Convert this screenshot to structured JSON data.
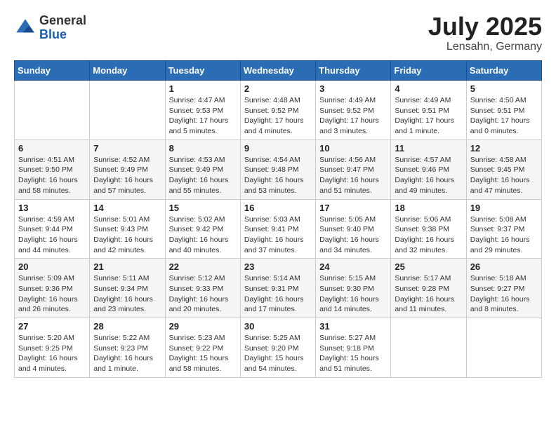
{
  "logo": {
    "general": "General",
    "blue": "Blue"
  },
  "title": "July 2025",
  "location": "Lensahn, Germany",
  "days_of_week": [
    "Sunday",
    "Monday",
    "Tuesday",
    "Wednesday",
    "Thursday",
    "Friday",
    "Saturday"
  ],
  "weeks": [
    [
      {
        "day": "",
        "sunrise": "",
        "sunset": "",
        "daylight": ""
      },
      {
        "day": "",
        "sunrise": "",
        "sunset": "",
        "daylight": ""
      },
      {
        "day": "1",
        "sunrise": "Sunrise: 4:47 AM",
        "sunset": "Sunset: 9:53 PM",
        "daylight": "Daylight: 17 hours and 5 minutes."
      },
      {
        "day": "2",
        "sunrise": "Sunrise: 4:48 AM",
        "sunset": "Sunset: 9:52 PM",
        "daylight": "Daylight: 17 hours and 4 minutes."
      },
      {
        "day": "3",
        "sunrise": "Sunrise: 4:49 AM",
        "sunset": "Sunset: 9:52 PM",
        "daylight": "Daylight: 17 hours and 3 minutes."
      },
      {
        "day": "4",
        "sunrise": "Sunrise: 4:49 AM",
        "sunset": "Sunset: 9:51 PM",
        "daylight": "Daylight: 17 hours and 1 minute."
      },
      {
        "day": "5",
        "sunrise": "Sunrise: 4:50 AM",
        "sunset": "Sunset: 9:51 PM",
        "daylight": "Daylight: 17 hours and 0 minutes."
      }
    ],
    [
      {
        "day": "6",
        "sunrise": "Sunrise: 4:51 AM",
        "sunset": "Sunset: 9:50 PM",
        "daylight": "Daylight: 16 hours and 58 minutes."
      },
      {
        "day": "7",
        "sunrise": "Sunrise: 4:52 AM",
        "sunset": "Sunset: 9:49 PM",
        "daylight": "Daylight: 16 hours and 57 minutes."
      },
      {
        "day": "8",
        "sunrise": "Sunrise: 4:53 AM",
        "sunset": "Sunset: 9:49 PM",
        "daylight": "Daylight: 16 hours and 55 minutes."
      },
      {
        "day": "9",
        "sunrise": "Sunrise: 4:54 AM",
        "sunset": "Sunset: 9:48 PM",
        "daylight": "Daylight: 16 hours and 53 minutes."
      },
      {
        "day": "10",
        "sunrise": "Sunrise: 4:56 AM",
        "sunset": "Sunset: 9:47 PM",
        "daylight": "Daylight: 16 hours and 51 minutes."
      },
      {
        "day": "11",
        "sunrise": "Sunrise: 4:57 AM",
        "sunset": "Sunset: 9:46 PM",
        "daylight": "Daylight: 16 hours and 49 minutes."
      },
      {
        "day": "12",
        "sunrise": "Sunrise: 4:58 AM",
        "sunset": "Sunset: 9:45 PM",
        "daylight": "Daylight: 16 hours and 47 minutes."
      }
    ],
    [
      {
        "day": "13",
        "sunrise": "Sunrise: 4:59 AM",
        "sunset": "Sunset: 9:44 PM",
        "daylight": "Daylight: 16 hours and 44 minutes."
      },
      {
        "day": "14",
        "sunrise": "Sunrise: 5:01 AM",
        "sunset": "Sunset: 9:43 PM",
        "daylight": "Daylight: 16 hours and 42 minutes."
      },
      {
        "day": "15",
        "sunrise": "Sunrise: 5:02 AM",
        "sunset": "Sunset: 9:42 PM",
        "daylight": "Daylight: 16 hours and 40 minutes."
      },
      {
        "day": "16",
        "sunrise": "Sunrise: 5:03 AM",
        "sunset": "Sunset: 9:41 PM",
        "daylight": "Daylight: 16 hours and 37 minutes."
      },
      {
        "day": "17",
        "sunrise": "Sunrise: 5:05 AM",
        "sunset": "Sunset: 9:40 PM",
        "daylight": "Daylight: 16 hours and 34 minutes."
      },
      {
        "day": "18",
        "sunrise": "Sunrise: 5:06 AM",
        "sunset": "Sunset: 9:38 PM",
        "daylight": "Daylight: 16 hours and 32 minutes."
      },
      {
        "day": "19",
        "sunrise": "Sunrise: 5:08 AM",
        "sunset": "Sunset: 9:37 PM",
        "daylight": "Daylight: 16 hours and 29 minutes."
      }
    ],
    [
      {
        "day": "20",
        "sunrise": "Sunrise: 5:09 AM",
        "sunset": "Sunset: 9:36 PM",
        "daylight": "Daylight: 16 hours and 26 minutes."
      },
      {
        "day": "21",
        "sunrise": "Sunrise: 5:11 AM",
        "sunset": "Sunset: 9:34 PM",
        "daylight": "Daylight: 16 hours and 23 minutes."
      },
      {
        "day": "22",
        "sunrise": "Sunrise: 5:12 AM",
        "sunset": "Sunset: 9:33 PM",
        "daylight": "Daylight: 16 hours and 20 minutes."
      },
      {
        "day": "23",
        "sunrise": "Sunrise: 5:14 AM",
        "sunset": "Sunset: 9:31 PM",
        "daylight": "Daylight: 16 hours and 17 minutes."
      },
      {
        "day": "24",
        "sunrise": "Sunrise: 5:15 AM",
        "sunset": "Sunset: 9:30 PM",
        "daylight": "Daylight: 16 hours and 14 minutes."
      },
      {
        "day": "25",
        "sunrise": "Sunrise: 5:17 AM",
        "sunset": "Sunset: 9:28 PM",
        "daylight": "Daylight: 16 hours and 11 minutes."
      },
      {
        "day": "26",
        "sunrise": "Sunrise: 5:18 AM",
        "sunset": "Sunset: 9:27 PM",
        "daylight": "Daylight: 16 hours and 8 minutes."
      }
    ],
    [
      {
        "day": "27",
        "sunrise": "Sunrise: 5:20 AM",
        "sunset": "Sunset: 9:25 PM",
        "daylight": "Daylight: 16 hours and 4 minutes."
      },
      {
        "day": "28",
        "sunrise": "Sunrise: 5:22 AM",
        "sunset": "Sunset: 9:23 PM",
        "daylight": "Daylight: 16 hours and 1 minute."
      },
      {
        "day": "29",
        "sunrise": "Sunrise: 5:23 AM",
        "sunset": "Sunset: 9:22 PM",
        "daylight": "Daylight: 15 hours and 58 minutes."
      },
      {
        "day": "30",
        "sunrise": "Sunrise: 5:25 AM",
        "sunset": "Sunset: 9:20 PM",
        "daylight": "Daylight: 15 hours and 54 minutes."
      },
      {
        "day": "31",
        "sunrise": "Sunrise: 5:27 AM",
        "sunset": "Sunset: 9:18 PM",
        "daylight": "Daylight: 15 hours and 51 minutes."
      },
      {
        "day": "",
        "sunrise": "",
        "sunset": "",
        "daylight": ""
      },
      {
        "day": "",
        "sunrise": "",
        "sunset": "",
        "daylight": ""
      }
    ]
  ]
}
